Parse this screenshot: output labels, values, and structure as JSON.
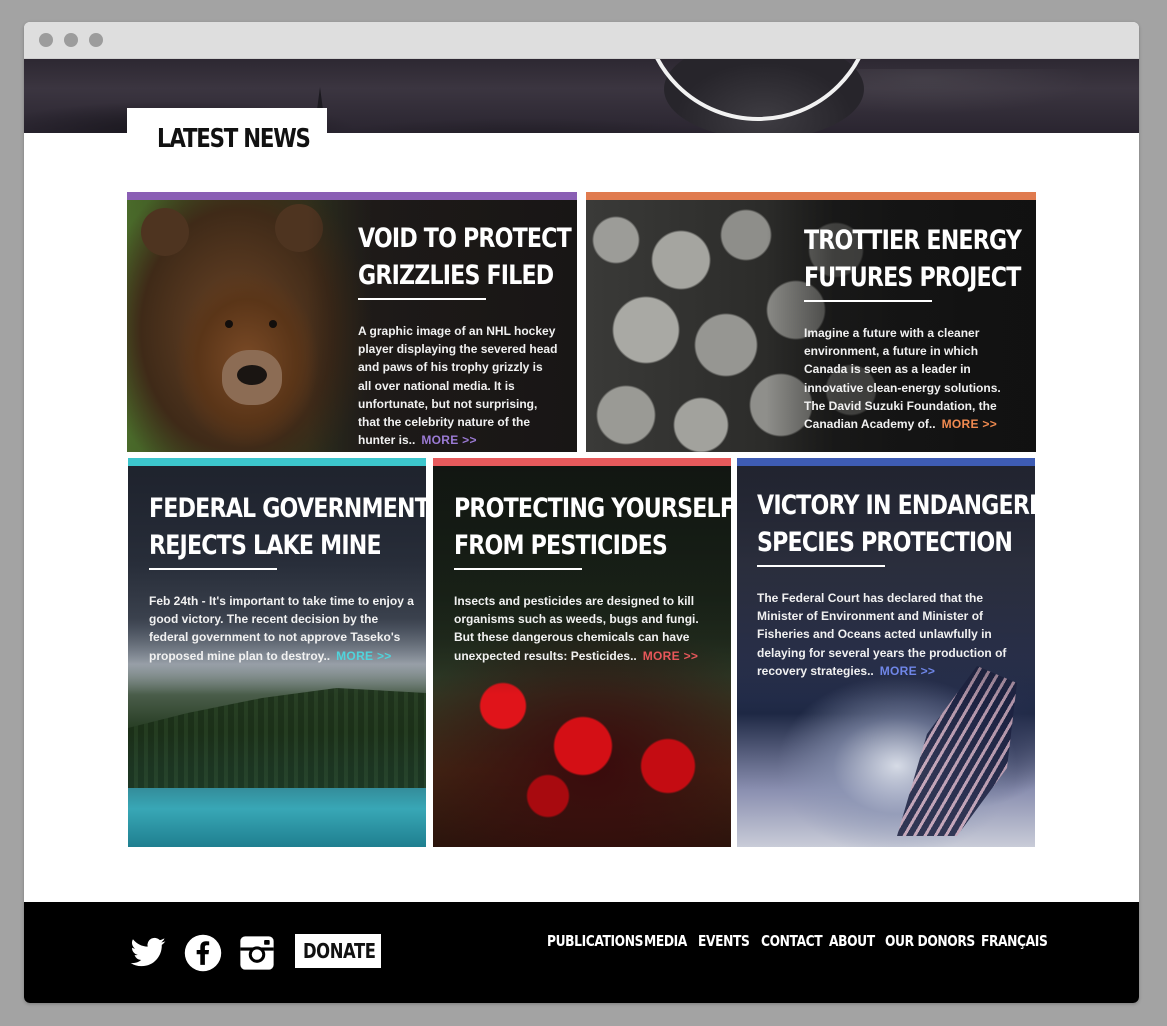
{
  "section_title": "LATEST NEWS",
  "more_label": "MORE >>",
  "cards": [
    {
      "title_line1": "VOID TO PROTECT",
      "title_line2": "GRIZZLIES FILED",
      "body": "A graphic image of an NHL hockey player displaying the severed head and paws of his trophy grizzly is all over national media. It is unfortunate, but not surprising, that the celebrity nature of the hunter is..",
      "accent": "#8a5fb4",
      "more_color": "#9b7ad4"
    },
    {
      "title_line1": "TROTTIER ENERGY",
      "title_line2": "FUTURES PROJECT",
      "body": "Imagine a future with a cleaner environment, a future in which Canada is seen as a leader in innovative clean-energy solutions. The David Suzuki Foundation, the Canadian Academy of..",
      "accent": "#e07b4f",
      "more_color": "#f08a50"
    },
    {
      "title_line1": "FEDERAL GOVERNMENT",
      "title_line2": "REJECTS LAKE MINE",
      "body": "Feb 24th - It's important to take time to enjoy a good victory. The recent decision by the federal government to not approve Taseko's proposed mine plan to destroy..",
      "accent": "#3cc5cc",
      "more_color": "#4fd4dc"
    },
    {
      "title_line1": "PROTECTING YOURSELF",
      "title_line2": "FROM PESTICIDES",
      "body": "Insects and pesticides are designed to kill organisms such as weeds, bugs and fungi. But these dangerous chemicals can have unexpected results: Pesticides..",
      "accent": "#e65a5c",
      "more_color": "#e8575a"
    },
    {
      "title_line1": "VICTORY IN ENDANGERED",
      "title_line2": "SPECIES PROTECTION",
      "body": "The Federal Court has declared that the Minister of Environment and Minister of Fisheries and Oceans acted unlawfully in delaying for several years the production of recovery strategies..",
      "accent": "#3e5cb4",
      "more_color": "#6f86e8"
    }
  ],
  "footer": {
    "donate_label": "DONATE",
    "social_icons": [
      "twitter-icon",
      "facebook-icon",
      "instagram-icon"
    ],
    "nav": [
      "PUBLICATIONS",
      "MEDIA",
      "EVENTS",
      "CONTACT",
      "ABOUT",
      "OUR DONORS",
      "FRANÇAIS"
    ]
  }
}
